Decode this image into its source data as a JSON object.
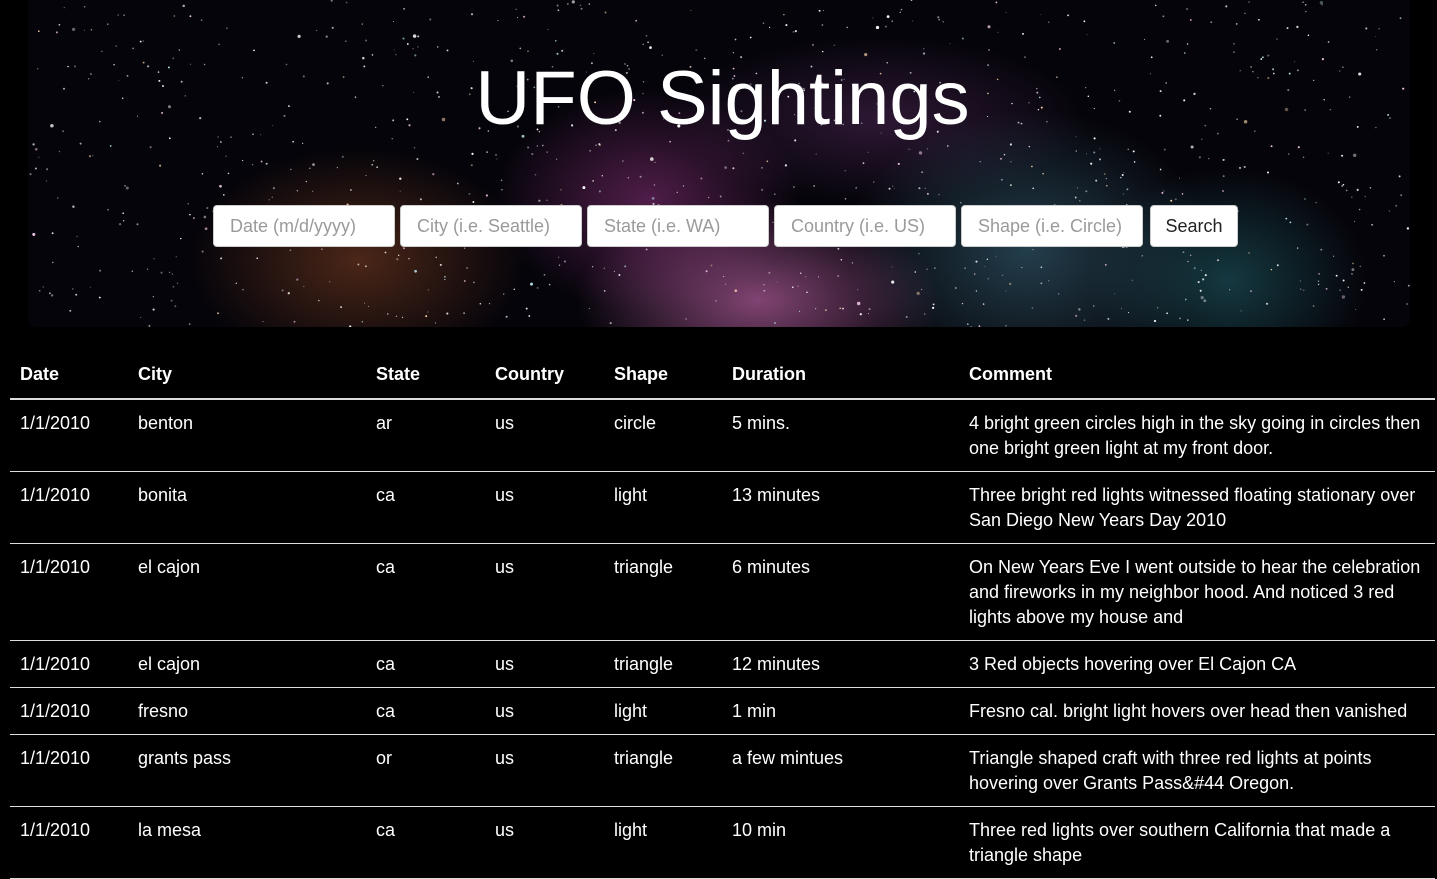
{
  "header": {
    "title": "UFO Sightings"
  },
  "search": {
    "date_placeholder": "Date (m/d/yyyy)",
    "city_placeholder": "City (i.e. Seattle)",
    "state_placeholder": "State (i.e. WA)",
    "country_placeholder": "Country (i.e. US)",
    "shape_placeholder": "Shape (i.e. Circle)",
    "button_label": "Search"
  },
  "table": {
    "columns": [
      "Date",
      "City",
      "State",
      "Country",
      "Shape",
      "Duration",
      "Comment"
    ],
    "rows": [
      [
        "1/1/2010",
        "benton",
        "ar",
        "us",
        "circle",
        "5 mins.",
        "4 bright green circles high in the sky going in circles then one bright green light at my front door."
      ],
      [
        "1/1/2010",
        "bonita",
        "ca",
        "us",
        "light",
        "13 minutes",
        "Three bright red lights witnessed floating stationary over San Diego New Years Day 2010"
      ],
      [
        "1/1/2010",
        "el cajon",
        "ca",
        "us",
        "triangle",
        "6 minutes",
        "On New Years Eve I went outside to hear the celebration and fireworks in my neighbor hood. And noticed 3 red lights above my house and"
      ],
      [
        "1/1/2010",
        "el cajon",
        "ca",
        "us",
        "triangle",
        "12 minutes",
        "3 Red objects hovering over El Cajon CA"
      ],
      [
        "1/1/2010",
        "fresno",
        "ca",
        "us",
        "light",
        "1 min",
        "Fresno cal. bright light hovers over head then vanished"
      ],
      [
        "1/1/2010",
        "grants pass",
        "or",
        "us",
        "triangle",
        "a few mintues",
        "Triangle shaped craft with three red lights at points hovering over Grants Pass&#44 Oregon."
      ],
      [
        "1/1/2010",
        "la mesa",
        "ca",
        "us",
        "light",
        "10 min",
        "Three red lights over southern California that made a triangle shape"
      ]
    ]
  }
}
